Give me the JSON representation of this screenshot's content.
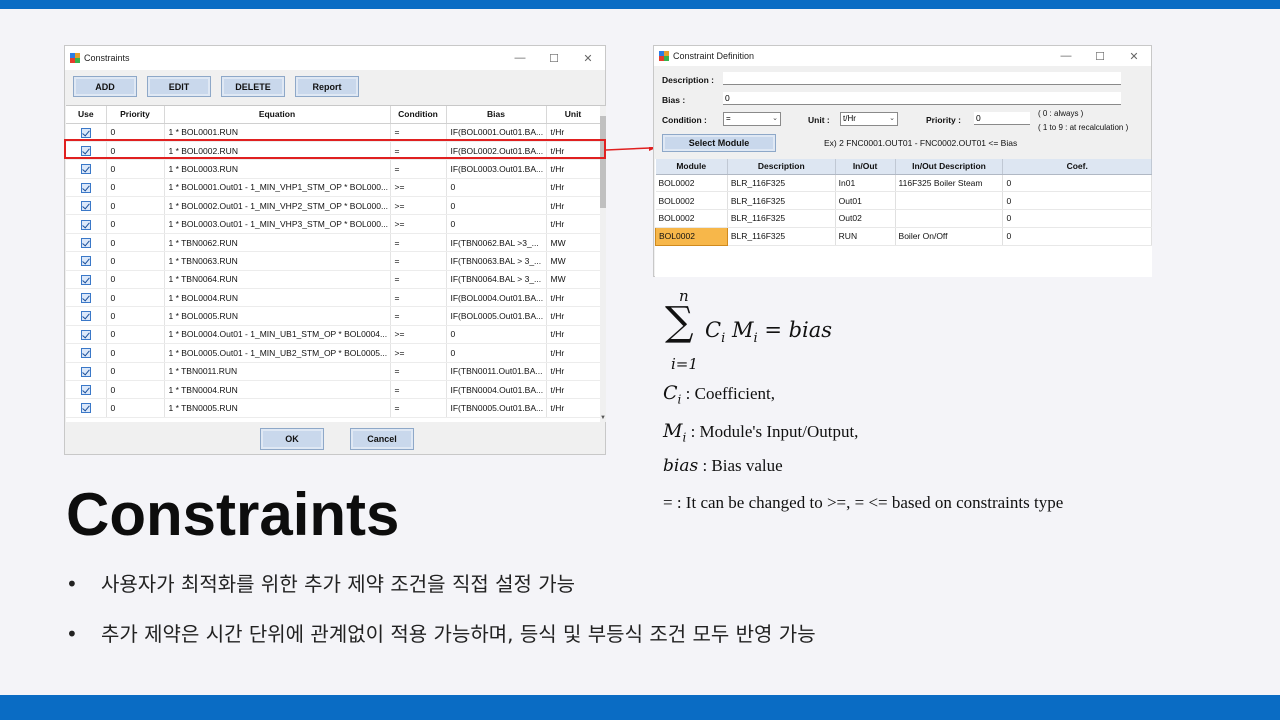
{
  "constraints_window": {
    "title": "Constraints",
    "toolbar": {
      "add": "ADD",
      "edit": "EDIT",
      "delete": "DELETE",
      "report": "Report"
    },
    "columns": [
      "Use",
      "Priority",
      "Equation",
      "Condition",
      "Bias",
      "Unit"
    ],
    "rows": [
      {
        "use": true,
        "priority": "0",
        "equation": "1 * BOL0001.RUN",
        "condition": "=",
        "bias": "IF(BOL0001.Out01.BA...",
        "unit": "t/Hr"
      },
      {
        "use": true,
        "priority": "0",
        "equation": "1 * BOL0002.RUN",
        "condition": "=",
        "bias": "IF(BOL0002.Out01.BA...",
        "unit": "t/Hr"
      },
      {
        "use": true,
        "priority": "0",
        "equation": "1 * BOL0003.RUN",
        "condition": "=",
        "bias": "IF(BOL0003.Out01.BA...",
        "unit": "t/Hr"
      },
      {
        "use": true,
        "priority": "0",
        "equation": "1 * BOL0001.Out01 - 1_MIN_VHP1_STM_OP * BOL000...",
        "condition": ">=",
        "bias": "0",
        "unit": "t/Hr"
      },
      {
        "use": true,
        "priority": "0",
        "equation": "1 * BOL0002.Out01 - 1_MIN_VHP2_STM_OP * BOL000...",
        "condition": ">=",
        "bias": "0",
        "unit": "t/Hr"
      },
      {
        "use": true,
        "priority": "0",
        "equation": "1 * BOL0003.Out01 - 1_MIN_VHP3_STM_OP * BOL000...",
        "condition": ">=",
        "bias": "0",
        "unit": "t/Hr"
      },
      {
        "use": true,
        "priority": "0",
        "equation": "1 * TBN0062.RUN",
        "condition": "=",
        "bias": "IF(TBN0062.BAL >3_...",
        "unit": "MW"
      },
      {
        "use": true,
        "priority": "0",
        "equation": "1 * TBN0063.RUN",
        "condition": "=",
        "bias": "IF(TBN0063.BAL > 3_...",
        "unit": "MW"
      },
      {
        "use": true,
        "priority": "0",
        "equation": "1 * TBN0064.RUN",
        "condition": "=",
        "bias": "IF(TBN0064.BAL > 3_...",
        "unit": "MW"
      },
      {
        "use": true,
        "priority": "0",
        "equation": "1 * BOL0004.RUN",
        "condition": "=",
        "bias": "IF(BOL0004.Out01.BA...",
        "unit": "t/Hr"
      },
      {
        "use": true,
        "priority": "0",
        "equation": "1 * BOL0005.RUN",
        "condition": "=",
        "bias": "IF(BOL0005.Out01.BA...",
        "unit": "t/Hr"
      },
      {
        "use": true,
        "priority": "0",
        "equation": "1 * BOL0004.Out01 - 1_MIN_UB1_STM_OP * BOL0004...",
        "condition": ">=",
        "bias": "0",
        "unit": "t/Hr"
      },
      {
        "use": true,
        "priority": "0",
        "equation": "1 * BOL0005.Out01 - 1_MIN_UB2_STM_OP * BOL0005...",
        "condition": ">=",
        "bias": "0",
        "unit": "t/Hr"
      },
      {
        "use": true,
        "priority": "0",
        "equation": "1 * TBN0011.RUN",
        "condition": "=",
        "bias": "IF(TBN0011.Out01.BA...",
        "unit": "t/Hr"
      },
      {
        "use": true,
        "priority": "0",
        "equation": "1 * TBN0004.RUN",
        "condition": "=",
        "bias": "IF(TBN0004.Out01.BA...",
        "unit": "t/Hr"
      },
      {
        "use": true,
        "priority": "0",
        "equation": "1 * TBN0005.RUN",
        "condition": "=",
        "bias": "IF(TBN0005.Out01.BA...",
        "unit": "t/Hr"
      }
    ],
    "ok": "OK",
    "cancel": "Cancel",
    "highlight_color": "#e02020"
  },
  "definition_window": {
    "title": "Constraint Definition",
    "description_label": "Description :",
    "description_value": "",
    "bias_label": "Bias :",
    "bias_value": "0",
    "condition_label": "Condition :",
    "condition_value": "=",
    "unit_label": "Unit :",
    "unit_value": "t/Hr",
    "priority_label": "Priority :",
    "priority_value": "0",
    "priority_hint1": "( 0 : always )",
    "priority_hint2": "( 1 to 9 : at recalculation )",
    "select_module": "Select Module",
    "example": "Ex) 2 FNC0001.OUT01 - FNC0002.OUT01 <= Bias",
    "columns": [
      "Module",
      "Description",
      "In/Out",
      "In/Out Description",
      "Coef."
    ],
    "rows": [
      {
        "module": "BOL0002",
        "description": "BLR_116F325",
        "inout": "In01",
        "inout_desc": "116F325 Boiler Steam",
        "coef": "0"
      },
      {
        "module": "BOL0002",
        "description": "BLR_116F325",
        "inout": "Out01",
        "inout_desc": "",
        "coef": "0"
      },
      {
        "module": "BOL0002",
        "description": "BLR_116F325",
        "inout": "Out02",
        "inout_desc": "",
        "coef": "0"
      },
      {
        "module": "BOL0002",
        "description": "BLR_116F325",
        "inout": "RUN",
        "inout_desc": "Boiler On/Off",
        "coef": "0"
      }
    ]
  },
  "formula": {
    "sum_upper": "n",
    "sum_symbol": "∑",
    "sum_lower": "i=1",
    "expression": "C",
    "legend": [
      {
        "sym": "C",
        "sub": "i",
        "text": " : Coefficient,"
      },
      {
        "sym": "M",
        "sub": "i",
        "text": " : Module's Input/Output,"
      },
      {
        "sym": "bias",
        "sub": "",
        "text": " : Bias value"
      }
    ],
    "note": "= : It can be changed to >=, = <= based on constraints type"
  },
  "slide": {
    "title": "Constraints",
    "bullets": [
      "사용자가 최적화를 위한 추가 제약 조건을 직접 설정 가능",
      "추가 제약은 시간 단위에 관계없이 적용 가능하며, 등식 및 부등식 조건 모두 반영 가능"
    ],
    "bullet_char": "•",
    "accent_color": "#0a6cc4"
  }
}
